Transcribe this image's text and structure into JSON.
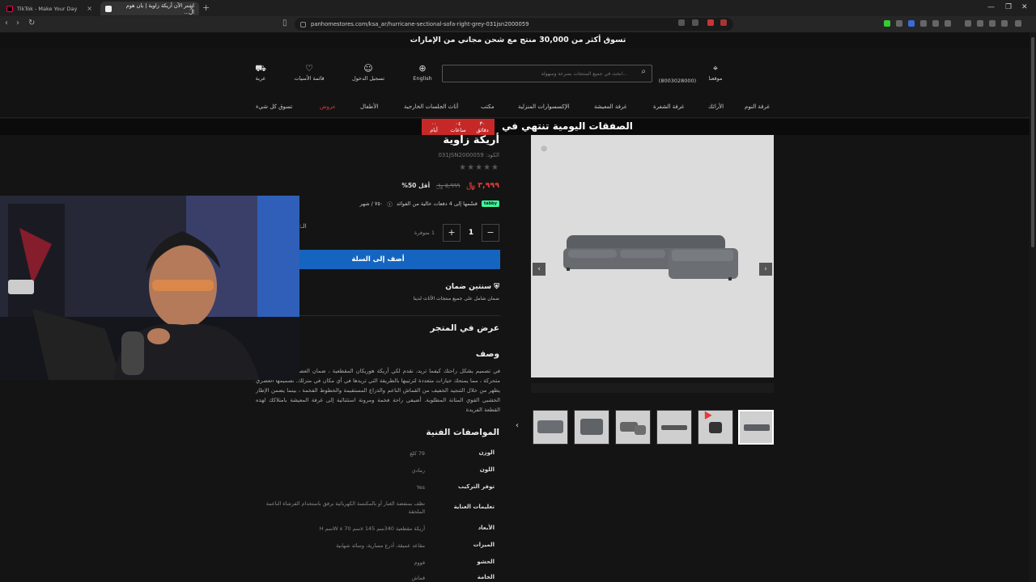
{
  "browser": {
    "tabs": [
      {
        "title": "TikTok - Make Your Day"
      },
      {
        "title": "اشتر الآن أريكة زاوية | بان هوم ال..."
      }
    ],
    "url": "panhomestores.com/ksa_ar/hurricane-sectional-sofa-right-grey-031jsn2000059"
  },
  "promo": {
    "text": "تسوق أكثر من 30,000 منتج مع شحن مجاني من الإمارات"
  },
  "header": {
    "location_label": "موقعنا",
    "phone": "(8003028000)",
    "search_placeholder": "ابحث في جميع المنتجات بسرعة وسهولة...",
    "language_label": "English",
    "login_label": "تسجيل الدخول",
    "wishlist_label": "قائمة الأمنيات",
    "cart_label": "عربة"
  },
  "categories": [
    "غرفة النوم",
    "الأرائك",
    "غرفة الشفرة",
    "غرفة المعيشة",
    "الإكسسوارات المنزلية",
    "مكتب",
    "أثاث الجلسات الخارجية",
    "الأطفال",
    "عروض",
    "تسوق كل شيء"
  ],
  "deals": {
    "title": "الصفقات اليومية تنتهي في",
    "timer": [
      {
        "value": "٣٠",
        "unit": "دقائق"
      },
      {
        "value": "٠٤",
        "unit": "ساعات"
      },
      {
        "value": "٠٠",
        "unit": "أيام"
      }
    ]
  },
  "product": {
    "name": "أريكة زاوية",
    "sku": "الكود: 031JSN2000059",
    "stars": "★★★★★",
    "price_now": "٣,٩٩٩ ﷼",
    "price_old": "٥,٩٩٩ ﷼",
    "discount": "أقل 50%",
    "installment_badge": "tabby",
    "installment_text": "قسّمها إلى 4 دفعات خالية من الفوائد",
    "installment_amount": "٧٥٠ / شهر",
    "qty": "1",
    "qty_plus": "+",
    "qty_minus": "−",
    "stock": "1 متوفرة",
    "add_to_cart": "أضف إلى السلة",
    "warranty_title": "سنتين ضمان",
    "warranty_text": "ضمان شامل على جميع منتجات الأثاث لدينا",
    "in_store": "عرض في المتجر",
    "description_title": "وصف",
    "description": "في تصميم يشكل راحتك كيفما تريد، نقدم لكي أريكة هوريكان المقطعية ، ضمان العصري بأقسام متعددة متحركة ، مما يمنحك خيارات متعددة لترتيبها بالطريقة التي تريدها في أي مكان في منزلك. تصميمها العصري يظهر من خلال التنجيد الخفيف من القماش الناعم والذراع المستقيمة والخطوط الفخمة ، بينما يضمن الإطار الخشبي القوي المتانة المطلوبة. أضيفي راحة فخمة ومرونة استثنائية إلى غرفة المعيشة بامتلاكك لهذه القطعة الفريدة",
    "specs_title": "المواصفات الفنية",
    "specs": [
      {
        "label": "الوزن",
        "value": "79 كلغ"
      },
      {
        "label": "اللون",
        "value": "رمادي"
      },
      {
        "label": "توفر التركيب",
        "value": "Yes"
      },
      {
        "label": "تعليمات العناية",
        "value": "نظف بمنفضة الغبار أو بالمكنسة الكهربائية برفق باستخدام الفرشاة الناعمة الملحقة"
      },
      {
        "label": "الأبعاد",
        "value": "أريكة مقطعية 340سم x 145سم W x 70سم H"
      },
      {
        "label": "الميزات",
        "value": "مقاعد عميقة، أذرع مسارية، وسائد شهابية"
      },
      {
        "label": "الحشو",
        "value": "فووم"
      },
      {
        "label": "الخامة",
        "value": "قماش"
      }
    ]
  },
  "webcam_cut_label": ":الـ",
  "colors": {
    "accent": "#1565c0",
    "sale": "#e53935",
    "timer": "#c62828"
  }
}
